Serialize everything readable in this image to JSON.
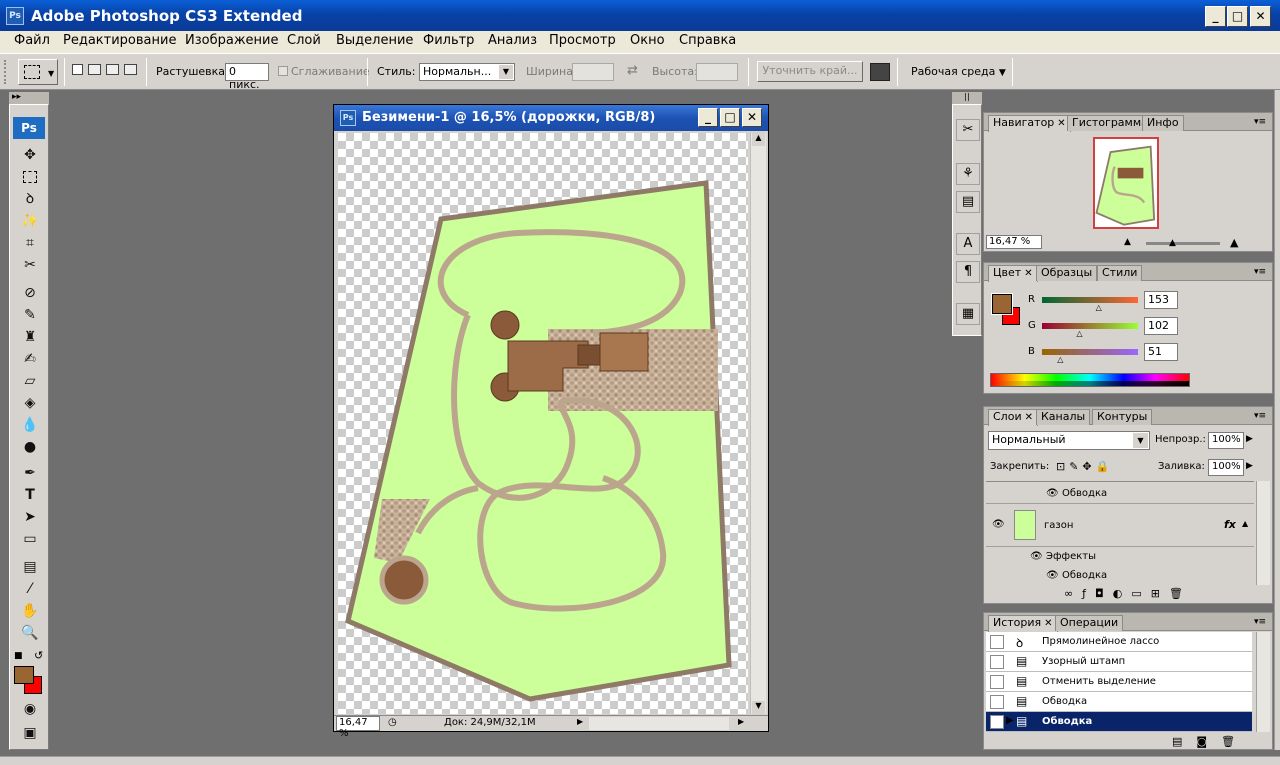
{
  "app": {
    "title": "Adobe Photoshop CS3 Extended",
    "logo": "Ps"
  },
  "window_controls": {
    "minimize": "_",
    "maximize": "□",
    "close": "✕"
  },
  "menu": [
    "Файл",
    "Редактирование",
    "Изображение",
    "Слой",
    "Выделение",
    "Фильтр",
    "Анализ",
    "Просмотр",
    "Окно",
    "Справка"
  ],
  "options": {
    "feather_label": "Растушевка:",
    "feather_value": "0 пикс.",
    "antialias_label": "Сглаживание",
    "style_label": "Стиль:",
    "style_value": "Нормальн...",
    "width_label": "Ширина:",
    "height_label": "Высота:",
    "refine_button": "Уточнить край...",
    "workspace": "Рабочая среда"
  },
  "toolbox": {
    "logo": "Ps"
  },
  "document": {
    "title": "Безимени-1 @ 16,5% (дорожки, RGB/8)",
    "icon": "Ps",
    "zoom": "16,47 %",
    "doc_size": "Док: 24,9M/32,1M"
  },
  "navigator": {
    "tabs": [
      "Навигатор",
      "Гистограмма",
      "Инфо"
    ],
    "zoom": "16,47 %"
  },
  "color_panel": {
    "tabs": [
      "Цвет",
      "Образцы",
      "Стили"
    ],
    "foreground": "#996633",
    "background": "#ff0000",
    "channels": [
      {
        "label": "R",
        "value": "153",
        "level": 0.6
      },
      {
        "label": "G",
        "value": "102",
        "level": 0.4
      },
      {
        "label": "B",
        "value": "51",
        "level": 0.2
      }
    ]
  },
  "layers_panel": {
    "tabs": [
      "Слои",
      "Каналы",
      "Контуры"
    ],
    "blend_mode": "Нормальный",
    "opacity_label": "Непрозр.:",
    "opacity": "100%",
    "lock_label": "Закрепить:",
    "fill_label": "Заливка:",
    "fill": "100%",
    "rows": {
      "stroke_top": "Обводка",
      "layer_name": "газон",
      "fx": "fx",
      "effects": "Эффекты",
      "stroke_bottom": "Обводка"
    }
  },
  "history_panel": {
    "tabs": [
      "История",
      "Операции"
    ],
    "items": [
      "Прямолинейное лассо",
      "Узорный штамп",
      "Отменить выделение",
      "Обводка",
      "Обводка"
    ]
  },
  "colors": {
    "selection": "#0a246a",
    "lawn": "#ccff99",
    "path": "#b59c82",
    "roof": "#8a5a3a"
  }
}
